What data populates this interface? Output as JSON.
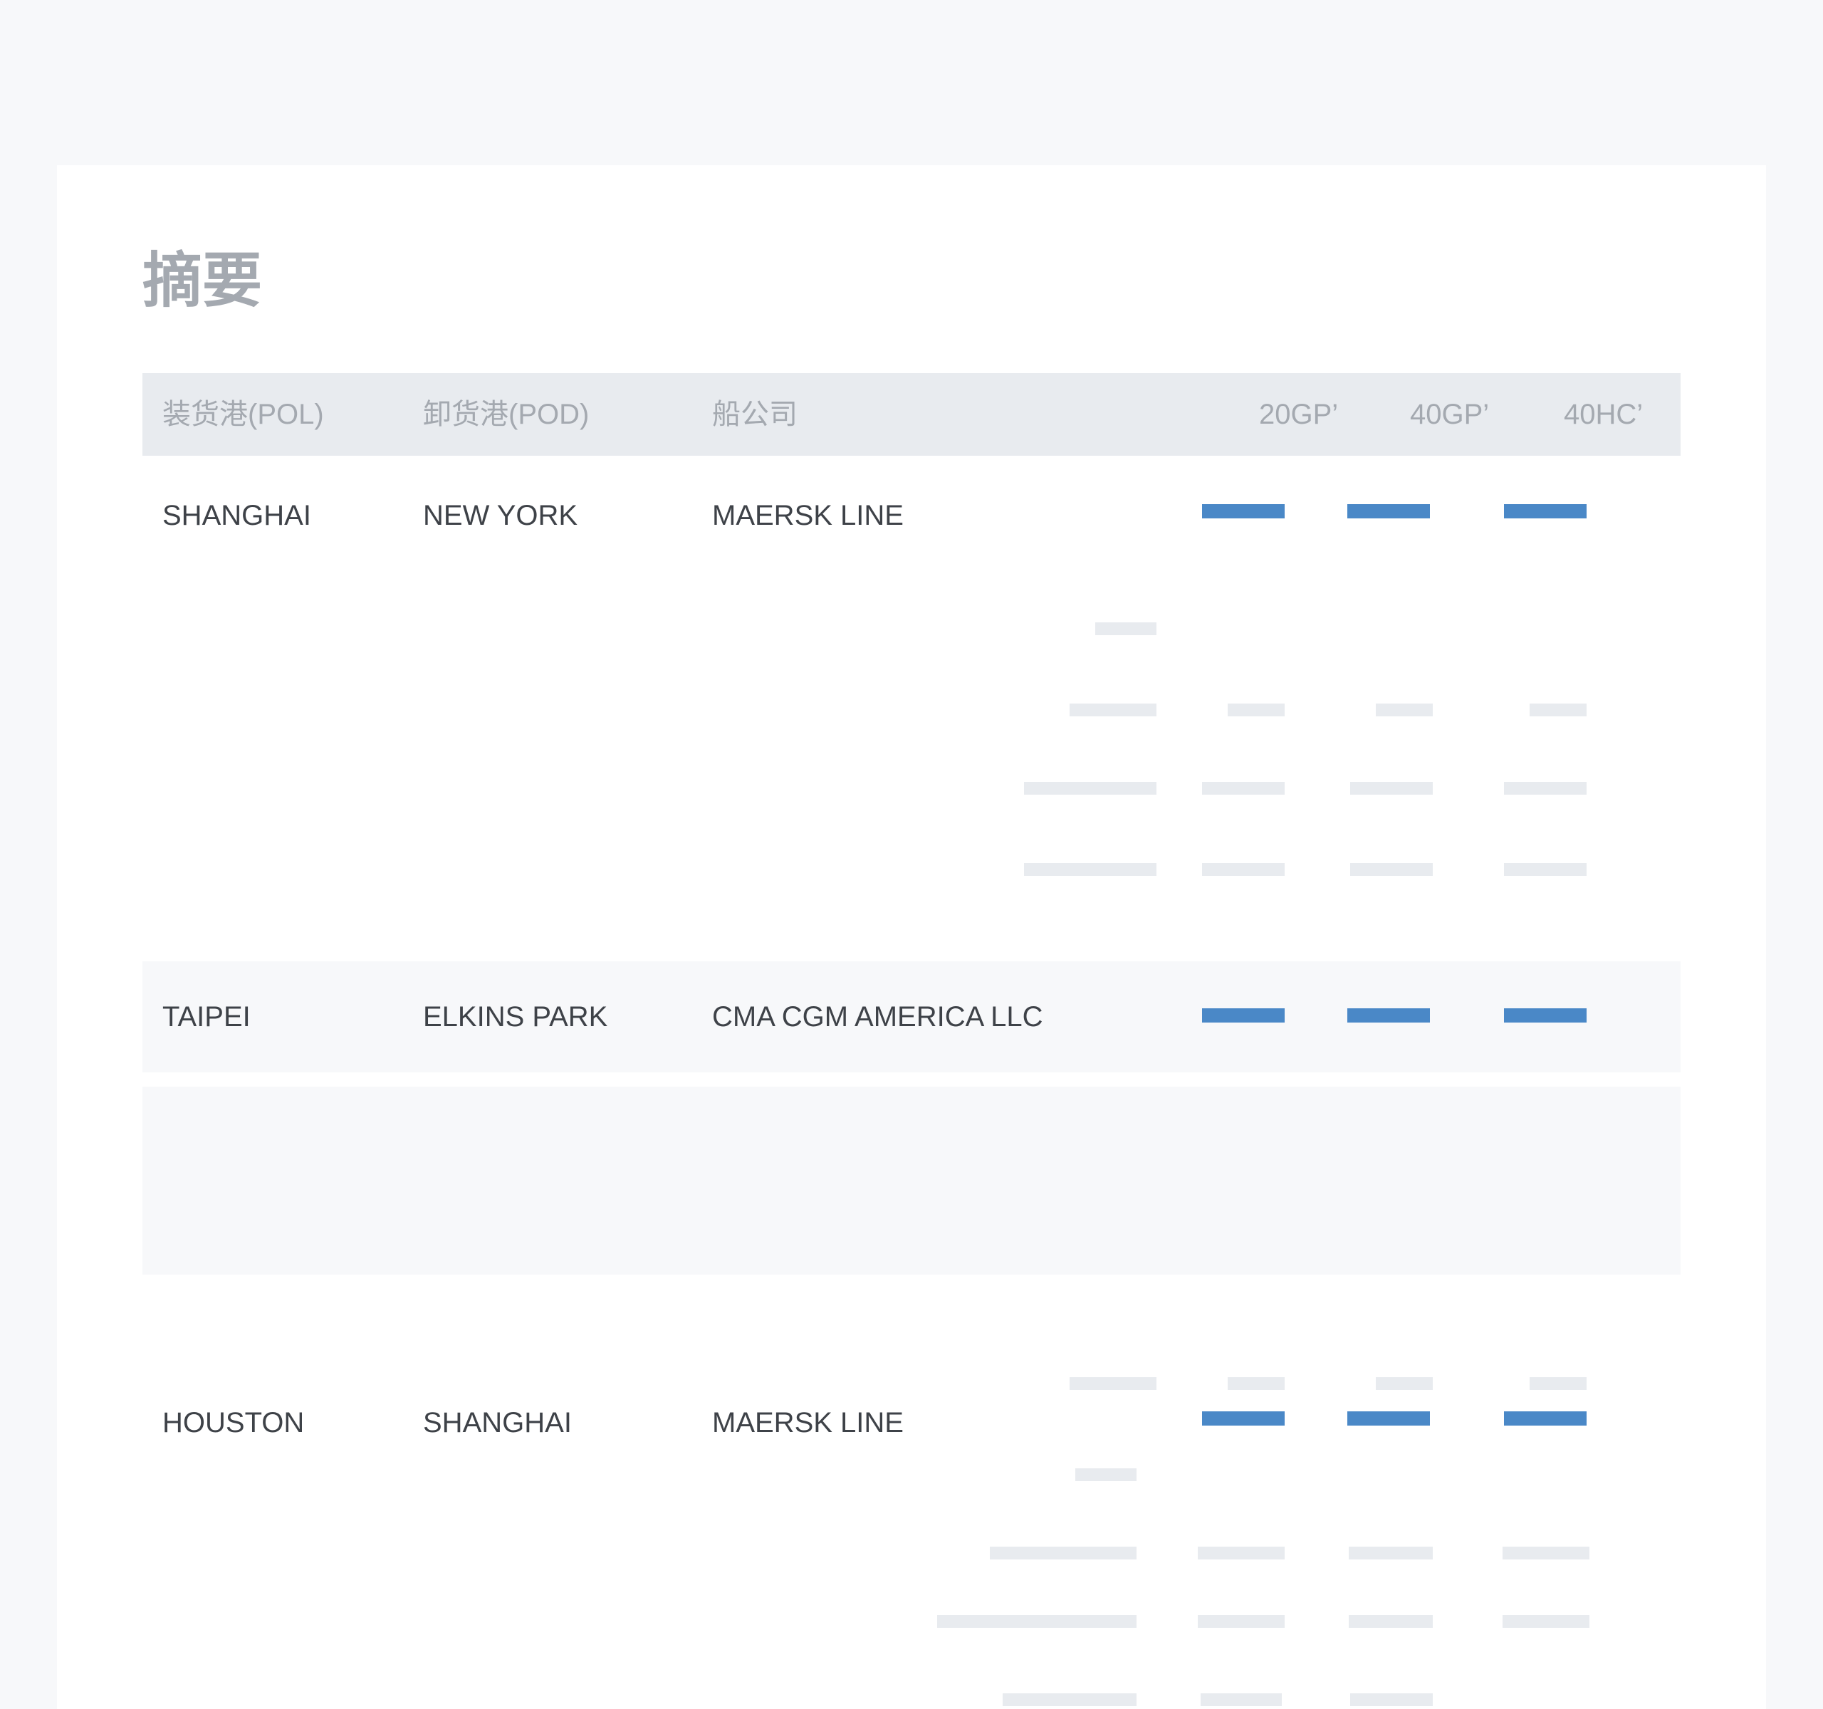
{
  "title": "摘要",
  "table": {
    "headers": {
      "pol": "装货港(POL)",
      "pod": "卸货港(POD)",
      "carrier": "船公司",
      "c20gp": "20GP’",
      "c40gp": "40GP’",
      "c40hc": "40HC’"
    },
    "rows": [
      {
        "pol": "SHANGHAI",
        "pod": "NEW YORK",
        "carrier": "MAERSK LINE"
      },
      {
        "pol": "TAIPEI",
        "pod": "ELKINS PARK",
        "carrier": "CMA CGM AMERICA LLC"
      },
      {
        "pol": "HOUSTON",
        "pod": "SHANGHAI",
        "carrier": "MAERSK LINE"
      }
    ]
  },
  "colors": {
    "price_bar": "#4a88c7",
    "skeleton": "#e8ebef",
    "header_bg": "#e8ebef",
    "band_bg": "#f7f8fa"
  }
}
